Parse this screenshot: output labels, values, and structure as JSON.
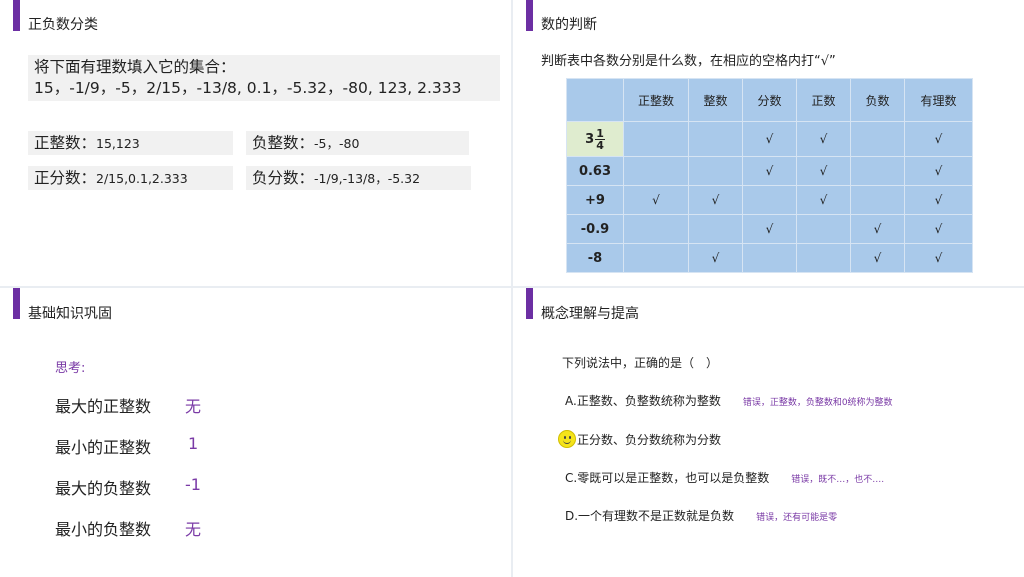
{
  "slide1": {
    "title": "正负数分类",
    "question_line1": "将下面有理数填入它的集合：",
    "question_line2": "15，-1/9，-5，2/15，-13/8, 0.1，-5.32，-80, 123, 2.333",
    "categories": [
      {
        "label": "正整数：",
        "value": "15,123"
      },
      {
        "label": "负整数：",
        "value": "-5，-80"
      },
      {
        "label": "正分数：",
        "value": "2/15,0.1,2.333"
      },
      {
        "label": "负分数：",
        "value": "-1/9,-13/8，-5.32"
      }
    ]
  },
  "slide2": {
    "title": "数的判断",
    "instruction": "判断表中各数分别是什么数，在相应的空格内打“√”",
    "headers": [
      "正整数",
      "整数",
      "分数",
      "正数",
      "负数",
      "有理数"
    ],
    "mixed_number": {
      "whole": "3",
      "numerator": "1",
      "denominator": "4"
    },
    "rows": [
      {
        "label": "",
        "cells": [
          "",
          "",
          "√",
          "√",
          "",
          "√"
        ]
      },
      {
        "label": "0.63",
        "cells": [
          "",
          "",
          "√",
          "√",
          "",
          "√"
        ]
      },
      {
        "label": "+9",
        "cells": [
          "√",
          "√",
          "",
          "√",
          "",
          "√"
        ]
      },
      {
        "label": "-0.9",
        "cells": [
          "",
          "",
          "√",
          "",
          "√",
          "√"
        ]
      },
      {
        "label": "-8",
        "cells": [
          "",
          "√",
          "",
          "",
          "√",
          "√"
        ]
      }
    ]
  },
  "slide3": {
    "title": "基础知识巩固",
    "think": "思考:",
    "items": [
      {
        "q": "最大的正整数",
        "a": "无"
      },
      {
        "q": "最小的正整数",
        "a": "1"
      },
      {
        "q": "最大的负整数",
        "a": "-1"
      },
      {
        "q": "最小的负整数",
        "a": "无"
      }
    ]
  },
  "slide4": {
    "title": "概念理解与提高",
    "question": "下列说法中，正确的是（　）",
    "options": [
      {
        "text": "A.正整数、负整数统称为整数",
        "note": "错误，正整数，负整数和0统称为整数"
      },
      {
        "text": "正分数、负分数统称为分数",
        "note": ""
      },
      {
        "text": "C.零既可以是正整数，也可以是负整数",
        "note": "错误，既不…，也不…."
      },
      {
        "text": "D.一个有理数不是正数就是负数",
        "note": "错误，还有可能是零"
      }
    ]
  }
}
